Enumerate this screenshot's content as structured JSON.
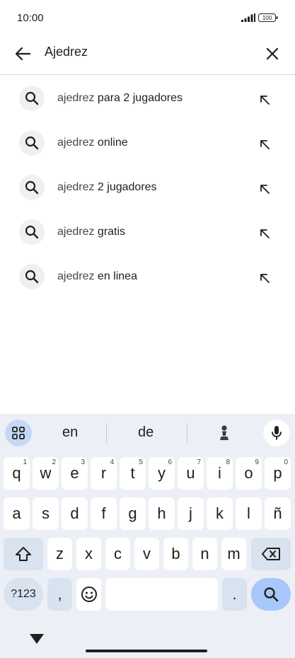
{
  "status": {
    "time": "10:00",
    "battery": "100"
  },
  "search": {
    "query": "Ajedrez"
  },
  "suggestions": [
    {
      "prefix": "ajedrez",
      "rest": " para 2 jugadores"
    },
    {
      "prefix": "ajedrez",
      "rest": " online"
    },
    {
      "prefix": "ajedrez",
      "rest": " 2 jugadores"
    },
    {
      "prefix": "ajedrez",
      "rest": " gratis"
    },
    {
      "prefix": "ajedrez",
      "rest": " en linea"
    }
  ],
  "keyboard": {
    "suggestions": [
      "en",
      "de"
    ],
    "row1": [
      {
        "k": "q",
        "h": "1"
      },
      {
        "k": "w",
        "h": "2"
      },
      {
        "k": "e",
        "h": "3"
      },
      {
        "k": "r",
        "h": "4"
      },
      {
        "k": "t",
        "h": "5"
      },
      {
        "k": "y",
        "h": "6"
      },
      {
        "k": "u",
        "h": "7"
      },
      {
        "k": "i",
        "h": "8"
      },
      {
        "k": "o",
        "h": "9"
      },
      {
        "k": "p",
        "h": "0"
      }
    ],
    "row2": [
      "a",
      "s",
      "d",
      "f",
      "g",
      "h",
      "j",
      "k",
      "l",
      "ñ"
    ],
    "row3": [
      "z",
      "x",
      "c",
      "v",
      "b",
      "n",
      "m"
    ],
    "symbols_label": "?123",
    "comma": ",",
    "period": "."
  },
  "colors": {
    "accent": "#a8c7fa",
    "keyboard_bg": "#eceff5",
    "function_key": "#d9e2ef"
  }
}
